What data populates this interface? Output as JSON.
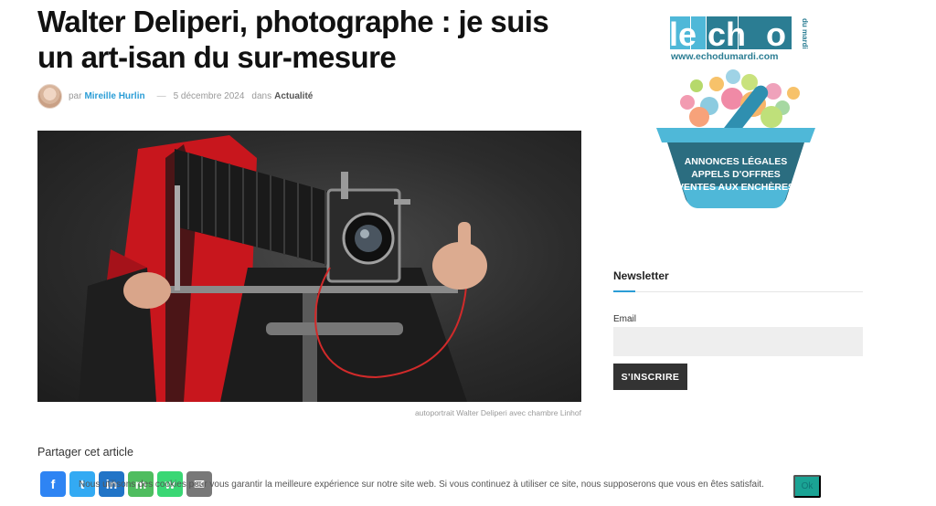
{
  "article": {
    "title": "Walter Deliperi, photographe : je suis un art-isan du sur-mesure",
    "meta": {
      "by": "par",
      "author": "Mireille Hurlin",
      "separator": "—",
      "date": "5 décembre 2024",
      "in": "dans",
      "category": "Actualité"
    },
    "image_caption": "autoportrait Walter Deliperi avec chambre Linhof",
    "share_title": "Partager cet article"
  },
  "share_buttons": [
    {
      "name": "Facebook",
      "glyph": "f",
      "color": "#1877f2"
    },
    {
      "name": "Twitter",
      "glyph": "t",
      "color": "#1da1f2"
    },
    {
      "name": "LinkedIn",
      "glyph": "in",
      "color": "#0a66c2"
    },
    {
      "name": "Messenger",
      "glyph": "m",
      "color": "#3db64e"
    },
    {
      "name": "WhatsApp",
      "glyph": "w",
      "color": "#25d366"
    },
    {
      "name": "Email",
      "glyph": "✉",
      "color": "#6a6a6a"
    }
  ],
  "sidebar": {
    "logo": {
      "brand_parts": [
        "le",
        "ch",
        "o"
      ],
      "brand_small": "du mardi",
      "url": "www.echodumardi.com",
      "lines": [
        "ANNONCES LÉGALES",
        "APPELS D'OFFRES",
        "VENTES AUX ENCHÈRES"
      ]
    },
    "newsletter": {
      "title": "Newsletter",
      "email_label": "Email",
      "email_value": "",
      "submit_label": "S'INSCRIRE"
    }
  },
  "cookie_banner": {
    "text": "Nous utilisons des cookies pour vous garantir la meilleure expérience sur notre site web. Si vous continuez à utiliser ce site, nous supposerons que vous en êtes satisfait.",
    "ok_label": "Ok"
  },
  "colors": {
    "accent": "#2b9dd6",
    "logo_teal": "#2b7d93",
    "logo_basket_blue": "#4fb8d8",
    "ok_button": "#1aa394"
  }
}
